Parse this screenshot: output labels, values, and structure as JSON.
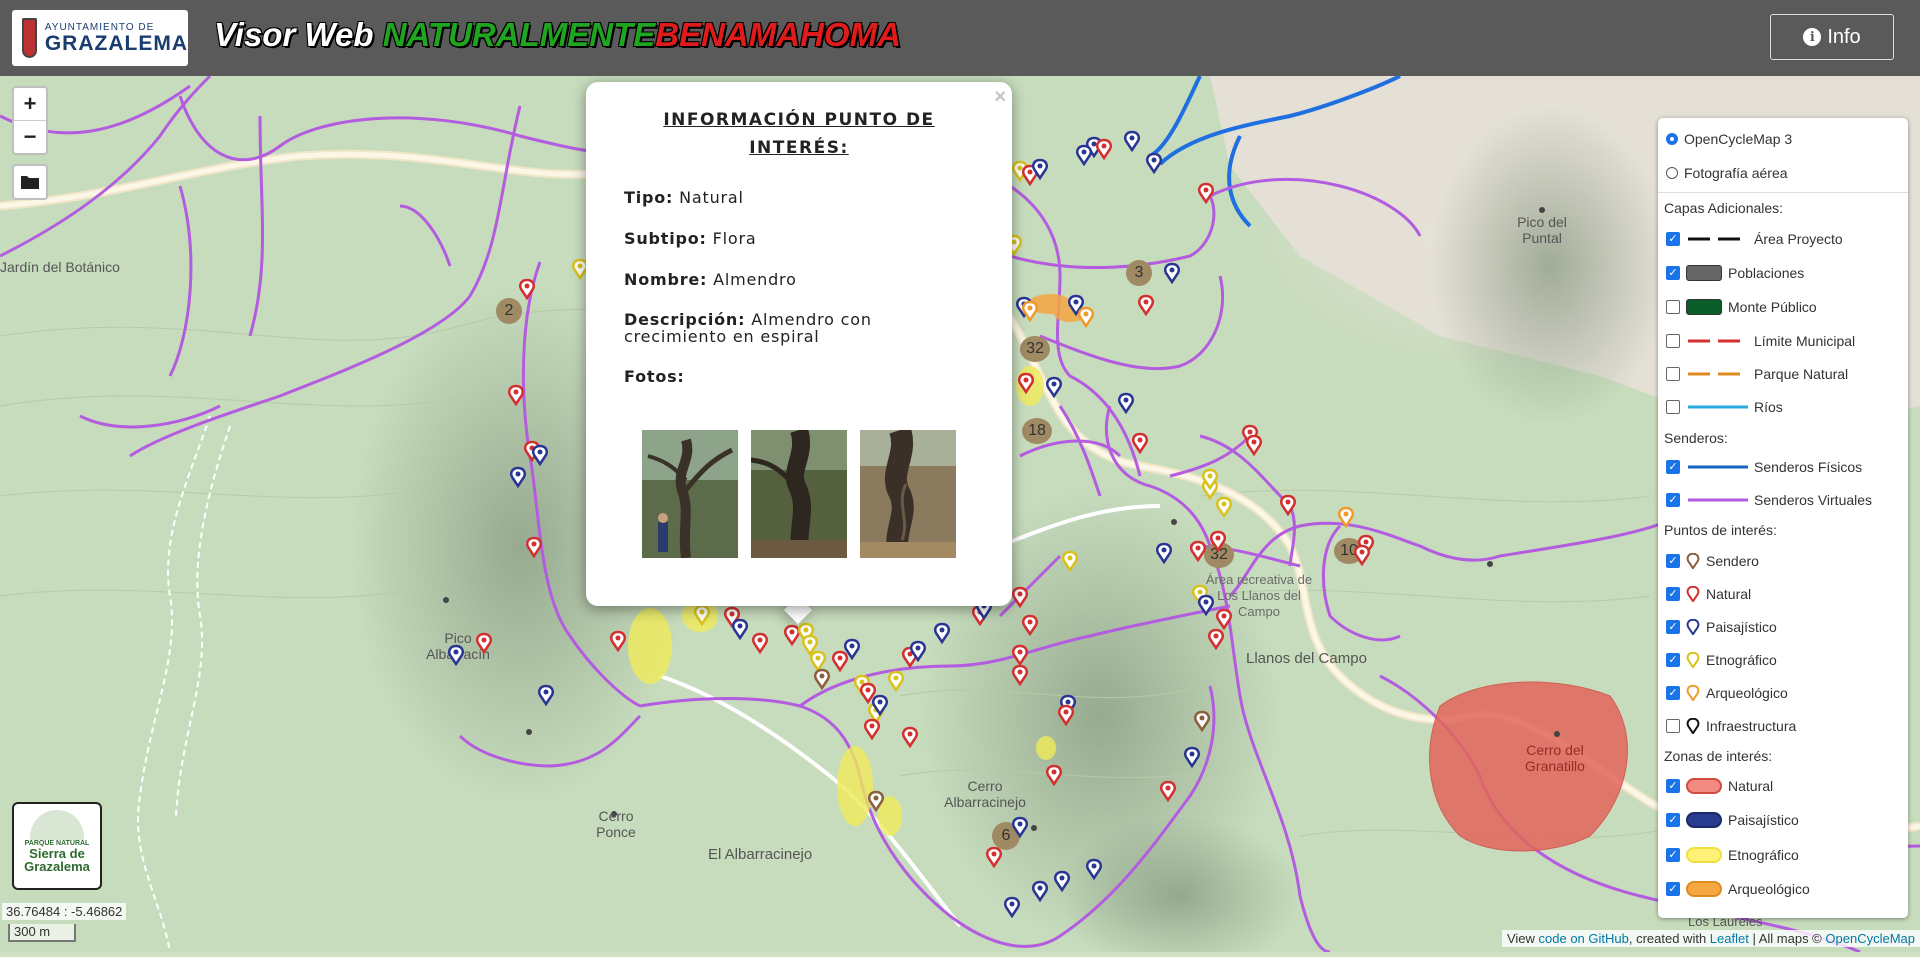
{
  "header": {
    "logo_sub": "AYUNTAMIENTO DE",
    "logo_main": "GRAZALEMA",
    "title_prefix": "Visor Web",
    "title_green": "NATURALMENTE",
    "title_red": "BENAMAHOMA",
    "info_label": "Info"
  },
  "map_controls": {
    "zoom_in": "+",
    "zoom_out": "−",
    "coords": "36.76484 : -5.46862",
    "scale": "300 m"
  },
  "map_labels": {
    "botanico": "Jardín del Botánico",
    "pico_puntal": "Pico del Puntal",
    "pico_albarracin": "Pico Albarracín",
    "cerro_ponce": "Cerro Ponce",
    "el_albarracinejo": "El Albarracinejo",
    "cerro_albarracinejo": "Cerro Albarracinejo",
    "llanos_del_campo": "Llanos del Campo",
    "area_recreativa": "Área recreativa de Los Llanos del Campo",
    "cerro_granatillo": "Cerro del Granatillo",
    "los_laureles": "Los Laureles",
    "clusters": [
      "2",
      "3",
      "32",
      "18",
      "32",
      "10",
      "6"
    ]
  },
  "popup": {
    "close": "×",
    "title": "INFORMACIÓN PUNTO DE INTERÉS:",
    "tipo_label": "Tipo:",
    "tipo": "Natural",
    "subtipo_label": "Subtipo:",
    "subtipo": "Flora",
    "nombre_label": "Nombre:",
    "nombre": "Almendro",
    "descripcion_label": "Descripción:",
    "descripcion": "Almendro con crecimiento en espiral",
    "fotos_label": "Fotos:"
  },
  "park_logo": {
    "small": "PARQUE NATURAL",
    "big_1": "Sierra de",
    "big_2": "Grazalema"
  },
  "attribution": {
    "view": "View ",
    "github": "code on GitHub",
    "created": ", created with ",
    "leaflet": "Leaflet",
    "maps": " | All maps © ",
    "ocm": "OpenCycleMap"
  },
  "layers": {
    "base": [
      {
        "label": "OpenCycleMap 3",
        "checked": true
      },
      {
        "label": "Fotografía aérea",
        "checked": false
      }
    ],
    "capas_title": "Capas Adicionales:",
    "capas": [
      {
        "label": "Área Proyecto",
        "checked": true,
        "color": "#111111"
      },
      {
        "label": "Poblaciones",
        "checked": true,
        "color": "#666666"
      },
      {
        "label": "Monte Público",
        "checked": false,
        "color": "#0b5d2a"
      },
      {
        "label": "Límite Municipal",
        "checked": false,
        "color": "#d32f2f"
      },
      {
        "label": "Parque Natural",
        "checked": false,
        "color": "#e08a1e"
      },
      {
        "label": "Ríos",
        "checked": false,
        "color": "#29a8e0"
      }
    ],
    "senderos_title": "Senderos:",
    "senderos": [
      {
        "label": "Senderos Físicos",
        "checked": true,
        "color": "#1565c0"
      },
      {
        "label": "Senderos Virtuales",
        "checked": true,
        "color": "#b45ce0"
      }
    ],
    "puntos_title": "Puntos de interés:",
    "puntos": [
      {
        "label": "Sendero",
        "checked": true,
        "color": "#8b5e3c"
      },
      {
        "label": "Natural",
        "checked": true,
        "color": "#d32f2f"
      },
      {
        "label": "Paisajístico",
        "checked": true,
        "color": "#283593"
      },
      {
        "label": "Etnográfico",
        "checked": true,
        "color": "#e6d21a"
      },
      {
        "label": "Arqueológico",
        "checked": true,
        "color": "#f09a2a"
      },
      {
        "label": "Infraestructura",
        "checked": false,
        "color": "#111111"
      }
    ],
    "zonas_title": "Zonas de interés:",
    "zonas": [
      {
        "label": "Natural",
        "checked": true,
        "color": "#f28b82"
      },
      {
        "label": "Paisajístico",
        "checked": true,
        "color": "#283d8f"
      },
      {
        "label": "Etnográfico",
        "checked": true,
        "color": "#fff176"
      },
      {
        "label": "Arqueológico",
        "checked": true,
        "color": "#f5a742"
      }
    ]
  }
}
